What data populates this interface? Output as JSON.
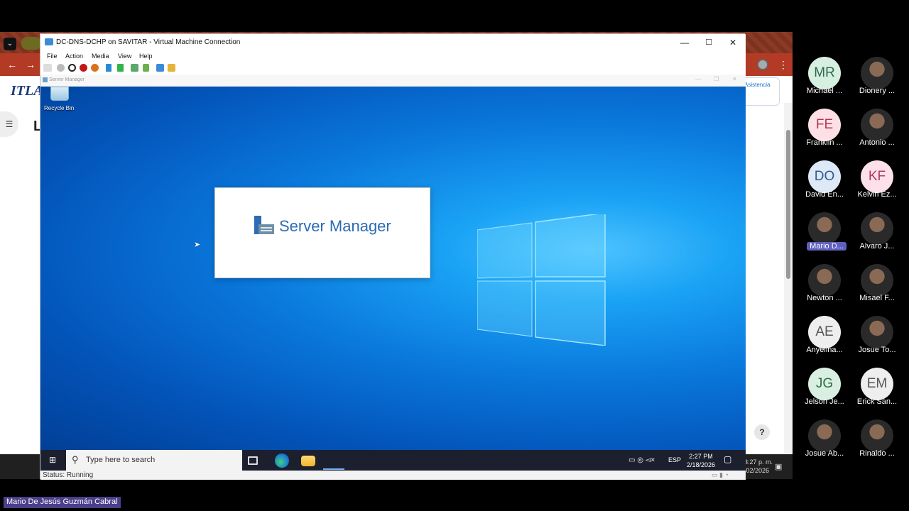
{
  "host": {
    "logo": "ITLA",
    "heading": "L",
    "asistencia": "Asistencia",
    "help": "?",
    "clock_time": "3:27 p. m.",
    "clock_date": "/02/2026"
  },
  "vm_window": {
    "title": "DC-DNS-DCHP on SAVITAR - Virtual Machine Connection",
    "menu": [
      "File",
      "Action",
      "Media",
      "View",
      "Help"
    ],
    "inner_title": "Server Manager",
    "status": "Status: Running"
  },
  "desktop": {
    "recycle_bin": "Recycle Bin",
    "splash_title": "Server Manager"
  },
  "vm_taskbar": {
    "search_placeholder": "Type here to search",
    "lang": "ESP",
    "time": "2:27 PM",
    "date": "2/18/2026"
  },
  "participants": [
    {
      "initials": "MR",
      "name": "Michael ...",
      "color": "#d6efe0",
      "text_color": "#2e6b4a"
    },
    {
      "initials": "",
      "name": "Dionery ...",
      "photo": true
    },
    {
      "initials": "FE",
      "name": "Franklin ...",
      "color": "#fde0e6",
      "text_color": "#b03a55"
    },
    {
      "initials": "",
      "name": "Antonio ...",
      "photo": true
    },
    {
      "initials": "DO",
      "name": "David En...",
      "color": "#dde9f7",
      "text_color": "#2f5c8f"
    },
    {
      "initials": "KF",
      "name": "Kelvin Ez...",
      "color": "#fde0ea",
      "text_color": "#b03a65"
    },
    {
      "initials": "",
      "name": "Mario D...",
      "photo": true,
      "highlight": true
    },
    {
      "initials": "",
      "name": "Alvaro J...",
      "photo": true
    },
    {
      "initials": "",
      "name": "Newton ...",
      "photo": true
    },
    {
      "initials": "",
      "name": "Misael F...",
      "photo": true
    },
    {
      "initials": "AE",
      "name": "Anyelina...",
      "color": "#eeeeee",
      "text_color": "#555555"
    },
    {
      "initials": "",
      "name": "Josue To...",
      "photo": true
    },
    {
      "initials": "JG",
      "name": "Jelson Je...",
      "color": "#d9efe1",
      "text_color": "#2e6b4a"
    },
    {
      "initials": "EM",
      "name": "Erick San...",
      "color": "#eeeeee",
      "text_color": "#555555"
    },
    {
      "initials": "",
      "name": "Josue Ab...",
      "photo": true
    },
    {
      "initials": "",
      "name": "Rinaldo ...",
      "photo": true
    }
  ],
  "presenter_label": "Mario De Jesús Guzmán Cabral"
}
